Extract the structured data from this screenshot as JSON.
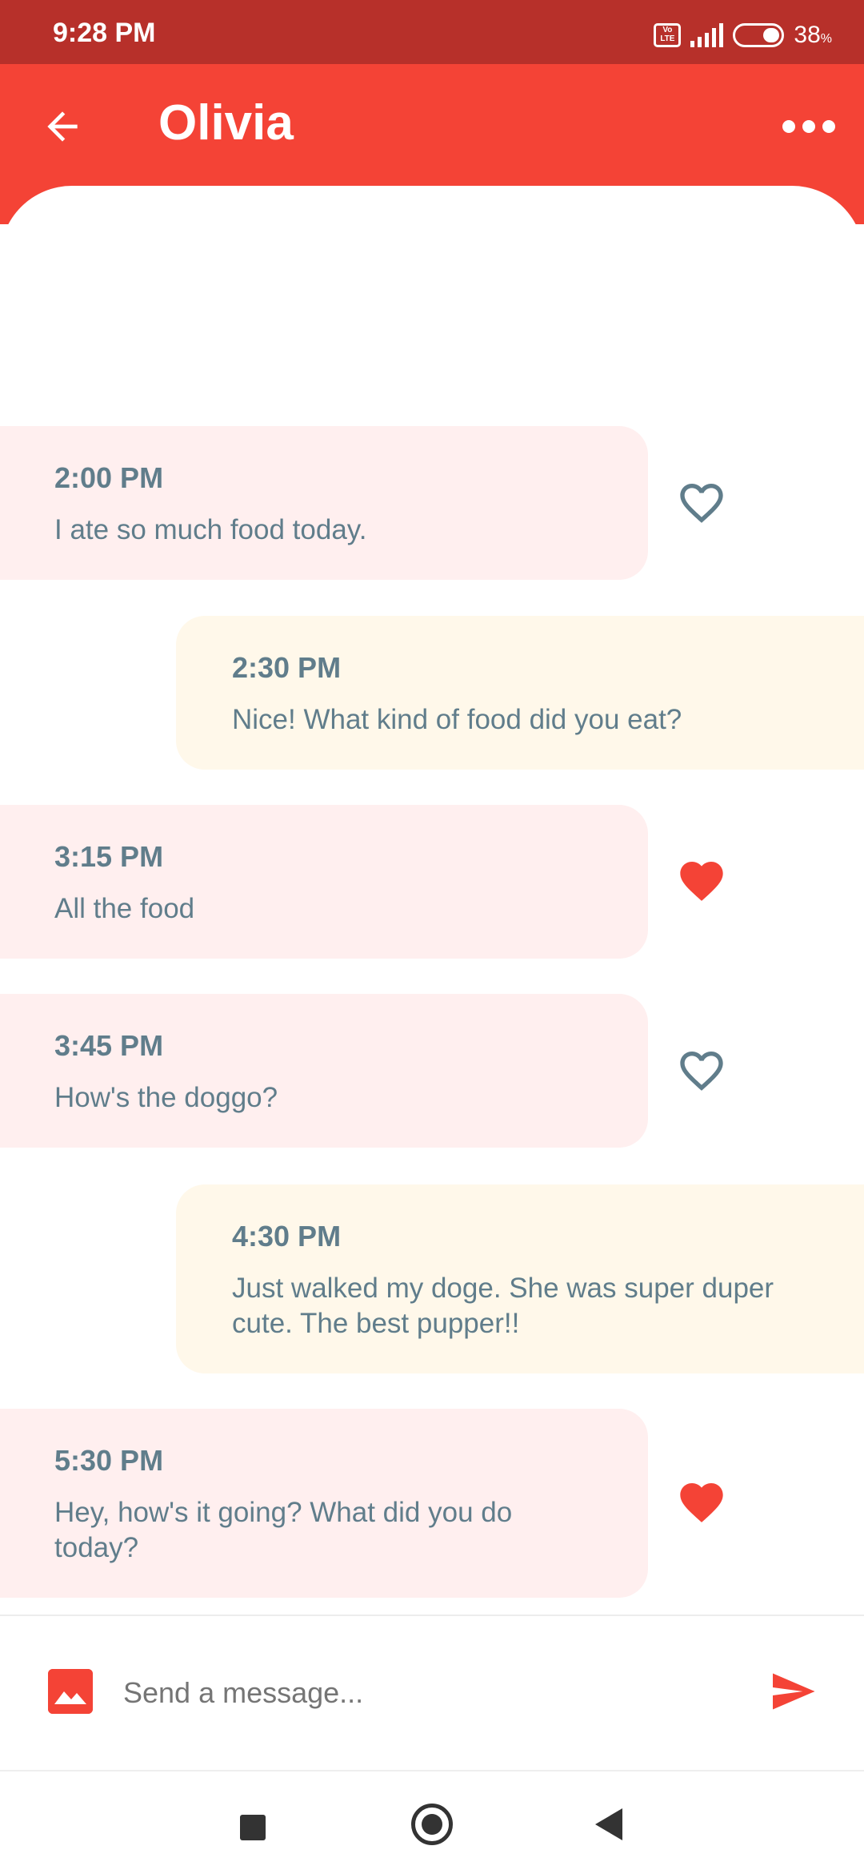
{
  "status_bar": {
    "time": "9:28 PM",
    "volte_label": "Vo LTE",
    "battery_percent": "38",
    "battery_unit": "%"
  },
  "app_bar": {
    "title": "Olivia",
    "back_icon": "arrow-left-icon",
    "more_icon": "more-horizontal-icon"
  },
  "colors": {
    "primary": "#f44336",
    "status_bar": "#b7302a",
    "incoming_bubble": "#ffefef",
    "outgoing_bubble": "#fff8ea",
    "message_text": "#607d8b",
    "heart_outline": "#607d8b",
    "heart_filled": "#f44336"
  },
  "messages": [
    {
      "direction": "incoming",
      "time": "2:00 PM",
      "text": "I ate so much food today.",
      "liked": false
    },
    {
      "direction": "outgoing",
      "time": "2:30 PM",
      "text": "Nice! What kind of food did you eat?"
    },
    {
      "direction": "incoming",
      "time": "3:15 PM",
      "text": "All the food",
      "liked": true
    },
    {
      "direction": "incoming",
      "time": "3:45 PM",
      "text": "How's the doggo?",
      "liked": false
    },
    {
      "direction": "outgoing",
      "time": "4:30 PM",
      "text": "Just walked my doge. She was super duper cute. The best pupper!!"
    },
    {
      "direction": "incoming",
      "time": "5:30 PM",
      "text": "Hey, how's it going? What did you do today?",
      "liked": true
    }
  ],
  "composer": {
    "placeholder": "Send a message...",
    "image_icon": "image-icon",
    "send_icon": "send-icon"
  },
  "nav_bar": {
    "recents_icon": "square-icon",
    "home_icon": "circle-icon",
    "back_icon": "triangle-back-icon"
  }
}
